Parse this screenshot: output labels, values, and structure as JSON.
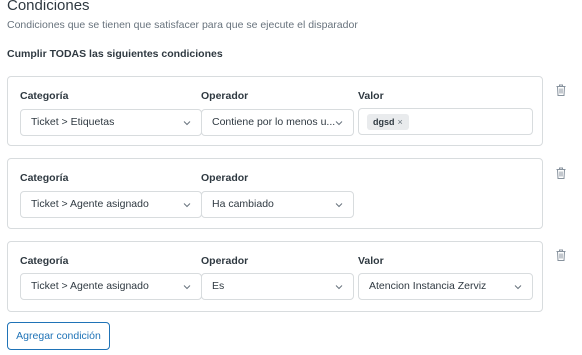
{
  "header": {
    "title": "Condiciones",
    "subtitle": "Condiciones que se tienen que satisfacer para que se ejecute el disparador",
    "rule_label": "Cumplir TODAS las siguientes condiciones"
  },
  "conditions": [
    {
      "category_label": "Categoría",
      "category_value": "Ticket > Etiquetas",
      "operator_label": "Operador",
      "operator_value": "Contiene por lo menos u...",
      "value_label": "Valor",
      "value_tag": "dgsd",
      "tag_remove": "×"
    },
    {
      "category_label": "Categoría",
      "category_value": "Ticket > Agente asignado",
      "operator_label": "Operador",
      "operator_value": "Ha cambiado"
    },
    {
      "category_label": "Categoría",
      "category_value": "Ticket > Agente asignado",
      "operator_label": "Operador",
      "operator_value": "Es",
      "value_label": "Valor",
      "value_value": "Atencion Instancia Zerviz"
    }
  ],
  "add_button": "Agregar condición",
  "icons": {
    "select": "chevron-down-icon",
    "delete": "trash-icon"
  },
  "colors": {
    "accent": "#1f73b7",
    "border": "#d8dcde",
    "text": "#2f3941",
    "muted": "#68737d"
  }
}
